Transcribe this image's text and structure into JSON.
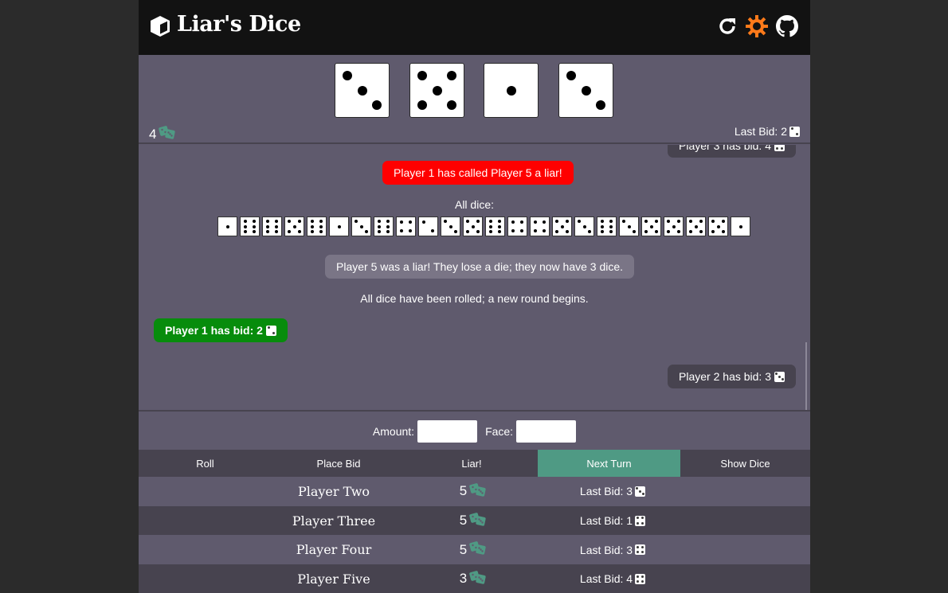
{
  "header": {
    "title": "Liar's Dice",
    "logo_icon": "cube-icon",
    "buttons": [
      {
        "name": "restart",
        "icon": "refresh-icon",
        "color": "#ffffff"
      },
      {
        "name": "theme",
        "icon": "sun-gear-icon",
        "color": "#ff7a1a"
      },
      {
        "name": "github",
        "icon": "github-icon",
        "color": "#ffffff"
      }
    ]
  },
  "my_hand": {
    "dice": [
      3,
      5,
      1,
      3
    ],
    "count": "4",
    "last_bid_label": "Last Bid: 2",
    "last_bid_face": 2
  },
  "log": {
    "partial_top": "Player 3 has bid: 4",
    "entries": [
      {
        "type": "red",
        "text": "Player 1 has called Player 5 a liar!"
      },
      {
        "type": "system",
        "text": "All dice:"
      },
      {
        "type": "light",
        "text": "Player 5 was a liar! They lose a die; they now have 3 dice."
      },
      {
        "type": "system",
        "text": "All dice have been rolled; a new round begins."
      },
      {
        "type": "green",
        "text": "Player 1 has bid: 2",
        "face": 2
      },
      {
        "type": "grey",
        "text": "Player 2 has bid: 3",
        "face": 3
      }
    ],
    "all_dice": [
      1,
      6,
      6,
      5,
      6,
      1,
      3,
      6,
      4,
      2,
      3,
      5,
      6,
      4,
      4,
      5,
      3,
      6,
      3,
      5,
      5,
      5,
      5,
      1
    ]
  },
  "bid_form": {
    "amount_label": "Amount:",
    "amount_value": "",
    "face_label": "Face:",
    "face_value": ""
  },
  "actions": [
    {
      "label": "Roll",
      "active": false
    },
    {
      "label": "Place Bid",
      "active": false
    },
    {
      "label": "Liar!",
      "active": false
    },
    {
      "label": "Next Turn",
      "active": true
    },
    {
      "label": "Show Dice",
      "active": false
    }
  ],
  "players": [
    {
      "name": "Player Two",
      "count": "5",
      "last_bid": "Last Bid: 3",
      "face": 3
    },
    {
      "name": "Player Three",
      "count": "5",
      "last_bid": "Last Bid: 1",
      "face": 4
    },
    {
      "name": "Player Four",
      "count": "5",
      "last_bid": "Last Bid: 3",
      "face": 4
    },
    {
      "name": "Player Five",
      "count": "3",
      "last_bid": "Last Bid: 4",
      "face": 4
    }
  ],
  "colors": {
    "accent": "#4f9a84",
    "dice_icon": "#4f9a84",
    "liar": "#ff0000",
    "my_bid": "#078c0c"
  }
}
